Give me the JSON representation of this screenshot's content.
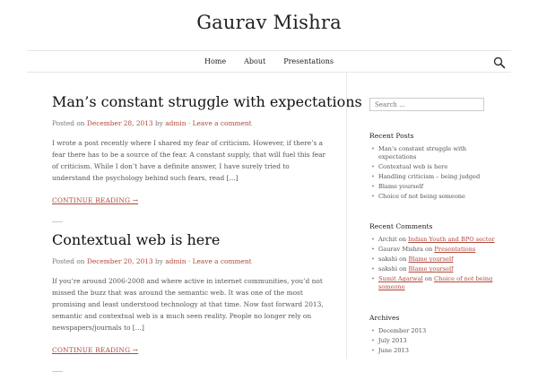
{
  "site": {
    "title": "Gaurav Mishra"
  },
  "nav": {
    "items": [
      "Home",
      "About",
      "Presentations"
    ]
  },
  "posts": [
    {
      "title": "Man’s constant struggle with expectations",
      "posted_on": "Posted on ",
      "date": "December 28, 2013",
      "by": " by ",
      "author": "admin",
      "sep": " · ",
      "comment_link": "Leave a comment",
      "excerpt": "I wrote a post recently where I shared my fear of criticism. However, if there’s a fear there has to be a source of the fear. A constant supply, that will fuel this fear of criticism. While I don’t have a definite answer, I have surely tried to understand the psychology behind such fears, read […]",
      "more": "CONTINUE READING →"
    },
    {
      "title": "Contextual web is here",
      "posted_on": "Posted on ",
      "date": "December 20, 2013",
      "by": " by ",
      "author": "admin",
      "sep": " · ",
      "comment_link": "Leave a comment",
      "excerpt": "If you’re around 2006-2008 and where active in internet communities, you’d not missed the buzz that was around the semantic web. It was one of the most promising and least understood technology at that time. Now fast forward 2013, semantic and contextual web is a much seen reality. People no longer rely on newspapers/journals to […]",
      "more": "CONTINUE READING →"
    }
  ],
  "sidebar": {
    "search_placeholder": "Search …",
    "recent_posts": {
      "title": "Recent Posts",
      "items": [
        "Man’s constant struggle with expectations",
        "Contextual web is here",
        "Handling criticism – being judged",
        "Blame yourself",
        "Choice of not being someone"
      ]
    },
    "recent_comments": {
      "title": "Recent Comments",
      "on": " on ",
      "items": [
        {
          "author": "Archit",
          "post": "Indian Youth and BPO sector"
        },
        {
          "author": "Gaurav Mishra",
          "post": "Presentations"
        },
        {
          "author": "sakshi",
          "post": "Blame yourself"
        },
        {
          "author": "sakshi",
          "post": "Blame yourself"
        },
        {
          "author": "Sumit Agarwal",
          "post": "Choice of not being someone"
        }
      ]
    },
    "archives": {
      "title": "Archives",
      "items": [
        "December 2013",
        "July 2013",
        "June 2013"
      ]
    }
  }
}
